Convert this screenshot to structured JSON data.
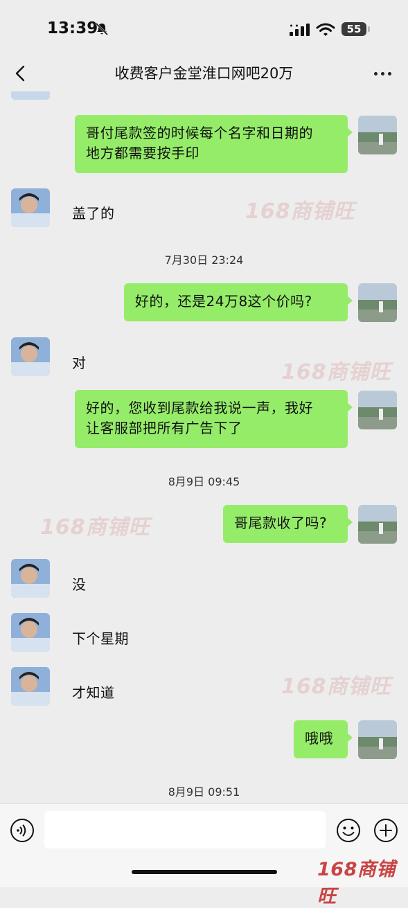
{
  "status_bar": {
    "time": "13:39",
    "battery": "55"
  },
  "nav": {
    "title": "收费客户金堂淮口网吧20万"
  },
  "messages": [
    {
      "side": "self",
      "text_lines": [
        "哥付尾款签的时候每个名字和日期的",
        "地方都需要按手印"
      ]
    },
    {
      "side": "other",
      "text": "盖了的"
    },
    {
      "type": "timestamp",
      "text": "7月30日 23:24"
    },
    {
      "side": "self",
      "text": "好的，还是24万8这个价吗?"
    },
    {
      "side": "other",
      "text": "对"
    },
    {
      "side": "self",
      "text_lines": [
        "好的，您收到尾款给我说一声，我好",
        "让客服部把所有广告下了"
      ]
    },
    {
      "type": "timestamp",
      "text": "8月9日 09:45"
    },
    {
      "side": "self",
      "text": "哥尾款收了吗?"
    },
    {
      "side": "other",
      "text": "没"
    },
    {
      "side": "other",
      "text": "下个星期"
    },
    {
      "side": "other",
      "text": "才知道"
    },
    {
      "side": "self",
      "text": "哦哦"
    },
    {
      "type": "timestamp",
      "text": "8月9日 09:51"
    }
  ],
  "watermark": {
    "text": "168商铺旺"
  },
  "input_bar": {
    "placeholder": ""
  },
  "icons": [
    "back-icon",
    "more-icon",
    "voice-icon",
    "emoji-icon",
    "plus-icon",
    "bell-muted-icon",
    "signal-icon",
    "wifi-icon",
    "battery-icon"
  ],
  "colors": {
    "self_bubble": "#95ec69",
    "background": "#ededed",
    "watermark": "#c94444"
  }
}
